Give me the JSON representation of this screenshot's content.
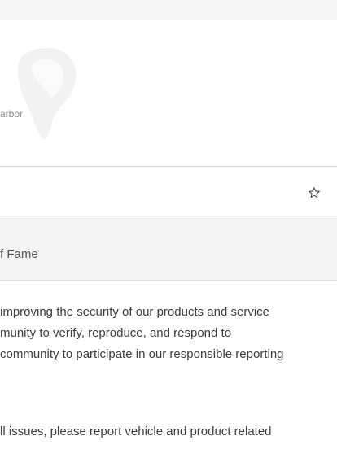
{
  "header": {
    "subtitle": "arbor"
  },
  "actions": {
    "favorite_icon": "star-outline-icon"
  },
  "tabs": {
    "active_label": "f Fame"
  },
  "content": {
    "paragraph1_lines": [
      "improving the security of our products and service",
      "munity to verify, reproduce, and respond to",
      "community to participate in our responsible reporting"
    ],
    "paragraph2_line": "ll issues, please report vehicle and product related"
  }
}
